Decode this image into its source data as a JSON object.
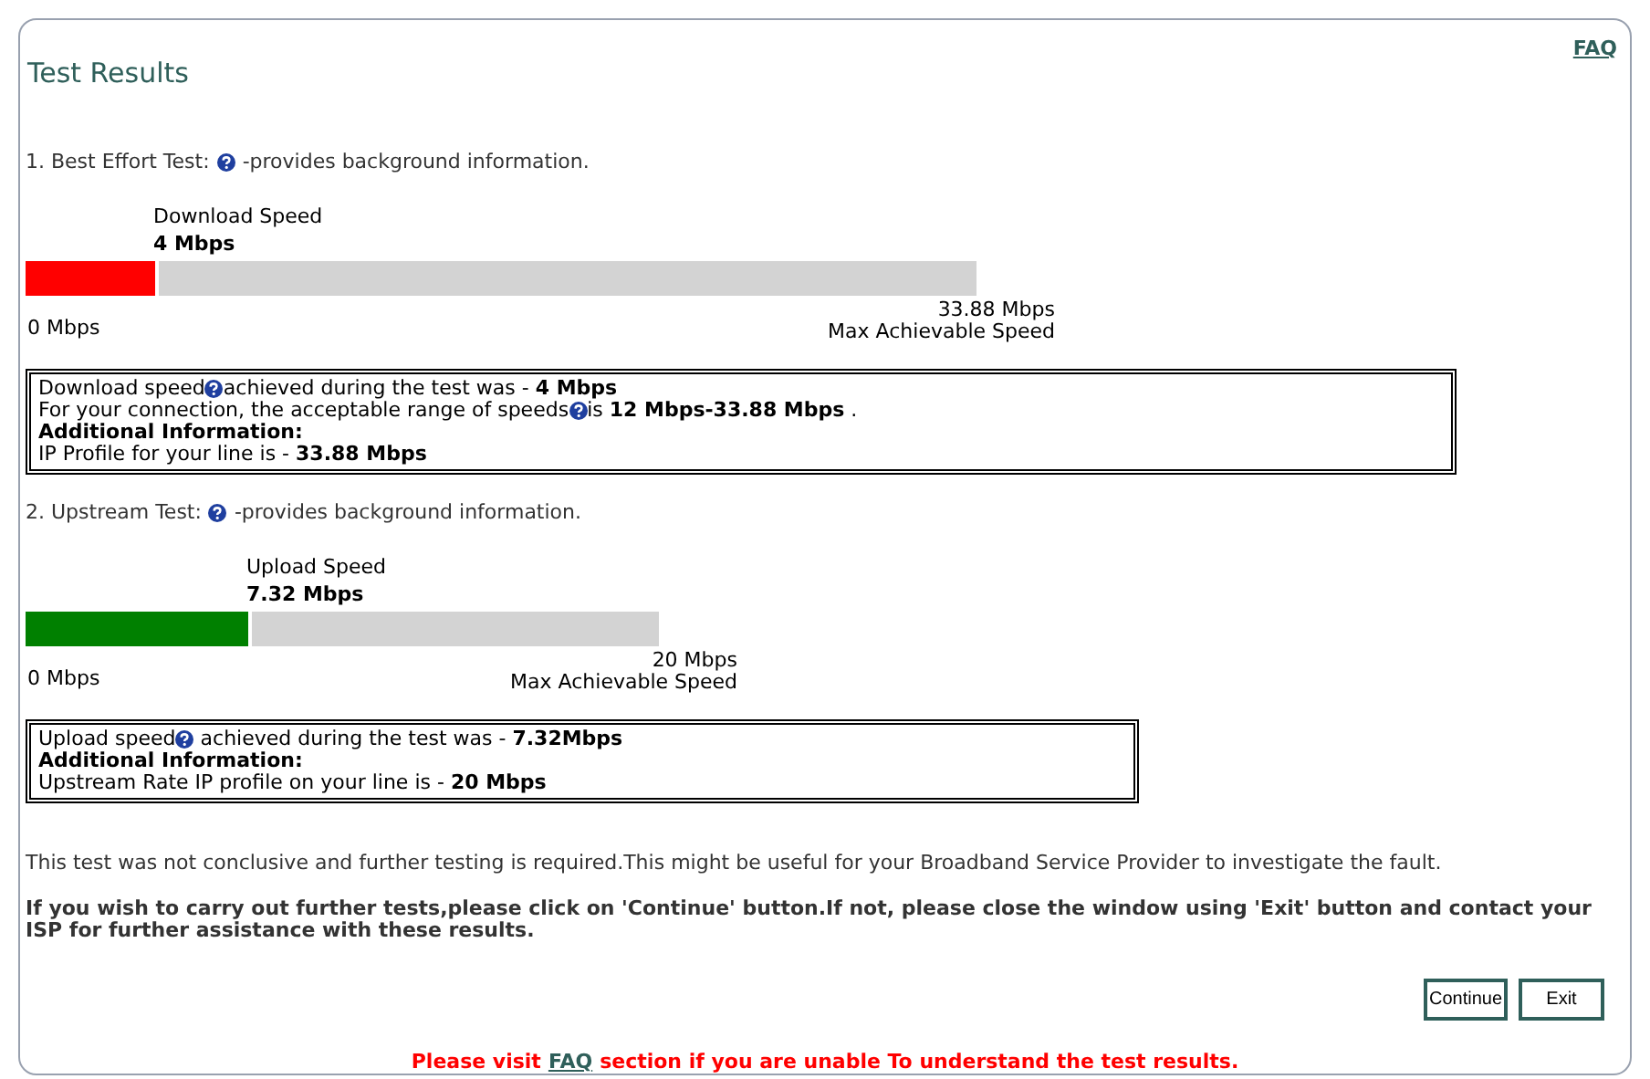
{
  "title": "Test Results",
  "faq_link": "FAQ",
  "tests": [
    {
      "heading_before": "1. Best Effort Test:",
      "heading_after": "-provides background information.",
      "bar_label": "Download Speed",
      "bar_value": "4 Mbps",
      "level": 0.14,
      "color": "#ff0000",
      "min_label": "0 Mbps",
      "max_label": "33.88 Mbps",
      "max_caption": "Max Achievable Speed",
      "info_lines": [
        [
          {
            "kind": "text",
            "text": "Download speed"
          },
          {
            "kind": "help"
          },
          {
            "kind": "text",
            "text": "achieved during the test was - **4 Mbps**"
          }
        ],
        [
          {
            "kind": "text",
            "text": "For your connection, the acceptable range of speeds"
          },
          {
            "kind": "help"
          },
          {
            "kind": "text",
            "text": "is **12 Mbps-33.88 Mbps** ."
          }
        ],
        [
          {
            "kind": "heading",
            "text": "Additional Information:"
          }
        ],
        [
          {
            "kind": "text",
            "text": "IP Profile for your line is - **33.88 Mbps**"
          }
        ]
      ]
    },
    {
      "heading_before": "2. Upstream Test:",
      "heading_after": "-provides background information.",
      "bar_label": "Upload Speed",
      "bar_value": "7.32 Mbps",
      "level": 0.357,
      "color": "#008000",
      "min_label": "0 Mbps",
      "max_label": "20 Mbps",
      "max_caption": "Max Achievable Speed",
      "info_lines": [
        [
          {
            "kind": "text",
            "text": "Upload speed"
          },
          {
            "kind": "help"
          },
          {
            "kind": "text",
            "text": " achieved during the test was - **7.32Mbps**"
          }
        ],
        [
          {
            "kind": "heading",
            "text": "Additional Information:"
          }
        ],
        [
          {
            "kind": "text",
            "text": "Upstream Rate IP profile on your line is - **20 Mbps**"
          }
        ]
      ]
    }
  ],
  "notice": "This test was not conclusive and further testing is required.This might be useful for your Broadband Service Provider to investigate the fault.",
  "instructions": "If you wish to carry out further tests,please click on 'Continue' button.If not, please close the window using 'Exit' button and contact your ISP for further assistance with these results.",
  "buttons": [
    "Continue",
    "Exit"
  ],
  "footer": {
    "before": "Please visit",
    "link": "FAQ",
    "after": "section if you are unable To understand the test results."
  }
}
